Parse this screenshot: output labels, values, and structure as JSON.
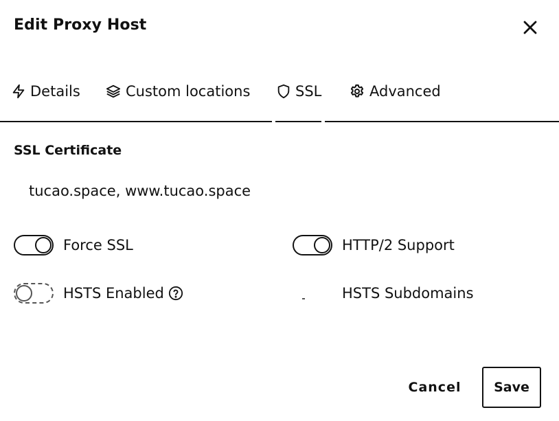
{
  "dialog": {
    "title": "Edit Proxy Host",
    "close_icon": "close-icon"
  },
  "tabs": [
    {
      "label": "Details",
      "icon": "lightning-icon"
    },
    {
      "label": "Custom locations",
      "icon": "layers-icon"
    },
    {
      "label": "SSL",
      "icon": "shield-icon",
      "active": true
    },
    {
      "label": "Advanced",
      "icon": "gear-icon"
    }
  ],
  "ssl": {
    "section_title": "SSL Certificate",
    "certificate_value": "tucao.space, www.tucao.space",
    "toggles": {
      "force_ssl": {
        "label": "Force SSL",
        "enabled": true
      },
      "http2_support": {
        "label": "HTTP/2 Support",
        "enabled": true
      },
      "hsts_enabled": {
        "label": "HSTS Enabled",
        "enabled": false,
        "help_icon": "help-circle-icon"
      },
      "hsts_subdomains": {
        "label": "HSTS Subdomains",
        "enabled": false
      }
    }
  },
  "footer": {
    "cancel_label": "Cancel",
    "save_label": "Save"
  }
}
